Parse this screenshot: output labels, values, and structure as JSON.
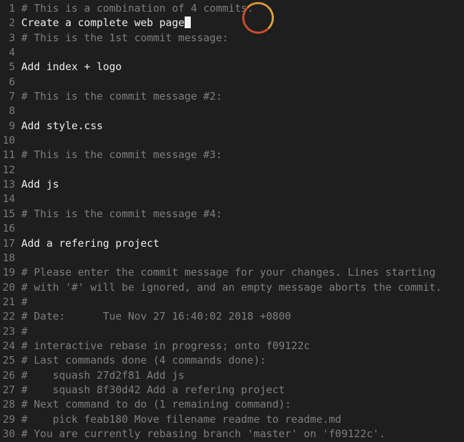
{
  "editor": {
    "lines": [
      {
        "num": "1",
        "text": "# This is a combination of 4 commits.",
        "comment": true
      },
      {
        "num": "2",
        "text": "Create a complete web page",
        "comment": false,
        "cursor": true
      },
      {
        "num": "3",
        "text": "# This is the 1st commit message:",
        "comment": true
      },
      {
        "num": "4",
        "text": "",
        "comment": false
      },
      {
        "num": "5",
        "text": "Add index + logo",
        "comment": false
      },
      {
        "num": "6",
        "text": "",
        "comment": false
      },
      {
        "num": "7",
        "text": "# This is the commit message #2:",
        "comment": true
      },
      {
        "num": "8",
        "text": "",
        "comment": false
      },
      {
        "num": "9",
        "text": "Add style.css",
        "comment": false
      },
      {
        "num": "10",
        "text": "",
        "comment": false
      },
      {
        "num": "11",
        "text": "# This is the commit message #3:",
        "comment": true
      },
      {
        "num": "12",
        "text": "",
        "comment": false
      },
      {
        "num": "13",
        "text": "Add js",
        "comment": false
      },
      {
        "num": "14",
        "text": "",
        "comment": false
      },
      {
        "num": "15",
        "text": "# This is the commit message #4:",
        "comment": true
      },
      {
        "num": "16",
        "text": "",
        "comment": false
      },
      {
        "num": "17",
        "text": "Add a refering project",
        "comment": false
      },
      {
        "num": "18",
        "text": "",
        "comment": false
      },
      {
        "num": "19",
        "text": "# Please enter the commit message for your changes. Lines starting",
        "comment": true
      },
      {
        "num": "20",
        "text": "# with '#' will be ignored, and an empty message aborts the commit.",
        "comment": true
      },
      {
        "num": "21",
        "text": "#",
        "comment": true
      },
      {
        "num": "22",
        "text": "# Date:      Tue Nov 27 16:40:02 2018 +0800",
        "comment": true
      },
      {
        "num": "23",
        "text": "#",
        "comment": true
      },
      {
        "num": "24",
        "text": "# interactive rebase in progress; onto f09122c",
        "comment": true
      },
      {
        "num": "25",
        "text": "# Last commands done (4 commands done):",
        "comment": true
      },
      {
        "num": "26",
        "text": "#    squash 27d2f81 Add js",
        "comment": true
      },
      {
        "num": "27",
        "text": "#    squash 8f30d42 Add a refering project",
        "comment": true
      },
      {
        "num": "28",
        "text": "# Next command to do (1 remaining command):",
        "comment": true
      },
      {
        "num": "29",
        "text": "#    pick feab180 Move filename readme to readme.md",
        "comment": true
      },
      {
        "num": "30",
        "text": "# You are currently rebasing branch 'master' on 'f09122c'.",
        "comment": true
      }
    ]
  },
  "colors": {
    "background": "#1e1e1e",
    "text": "#ececec",
    "comment": "#7e7e7e",
    "line_number": "#7a7a7a",
    "click_ring": "#e0522b"
  }
}
